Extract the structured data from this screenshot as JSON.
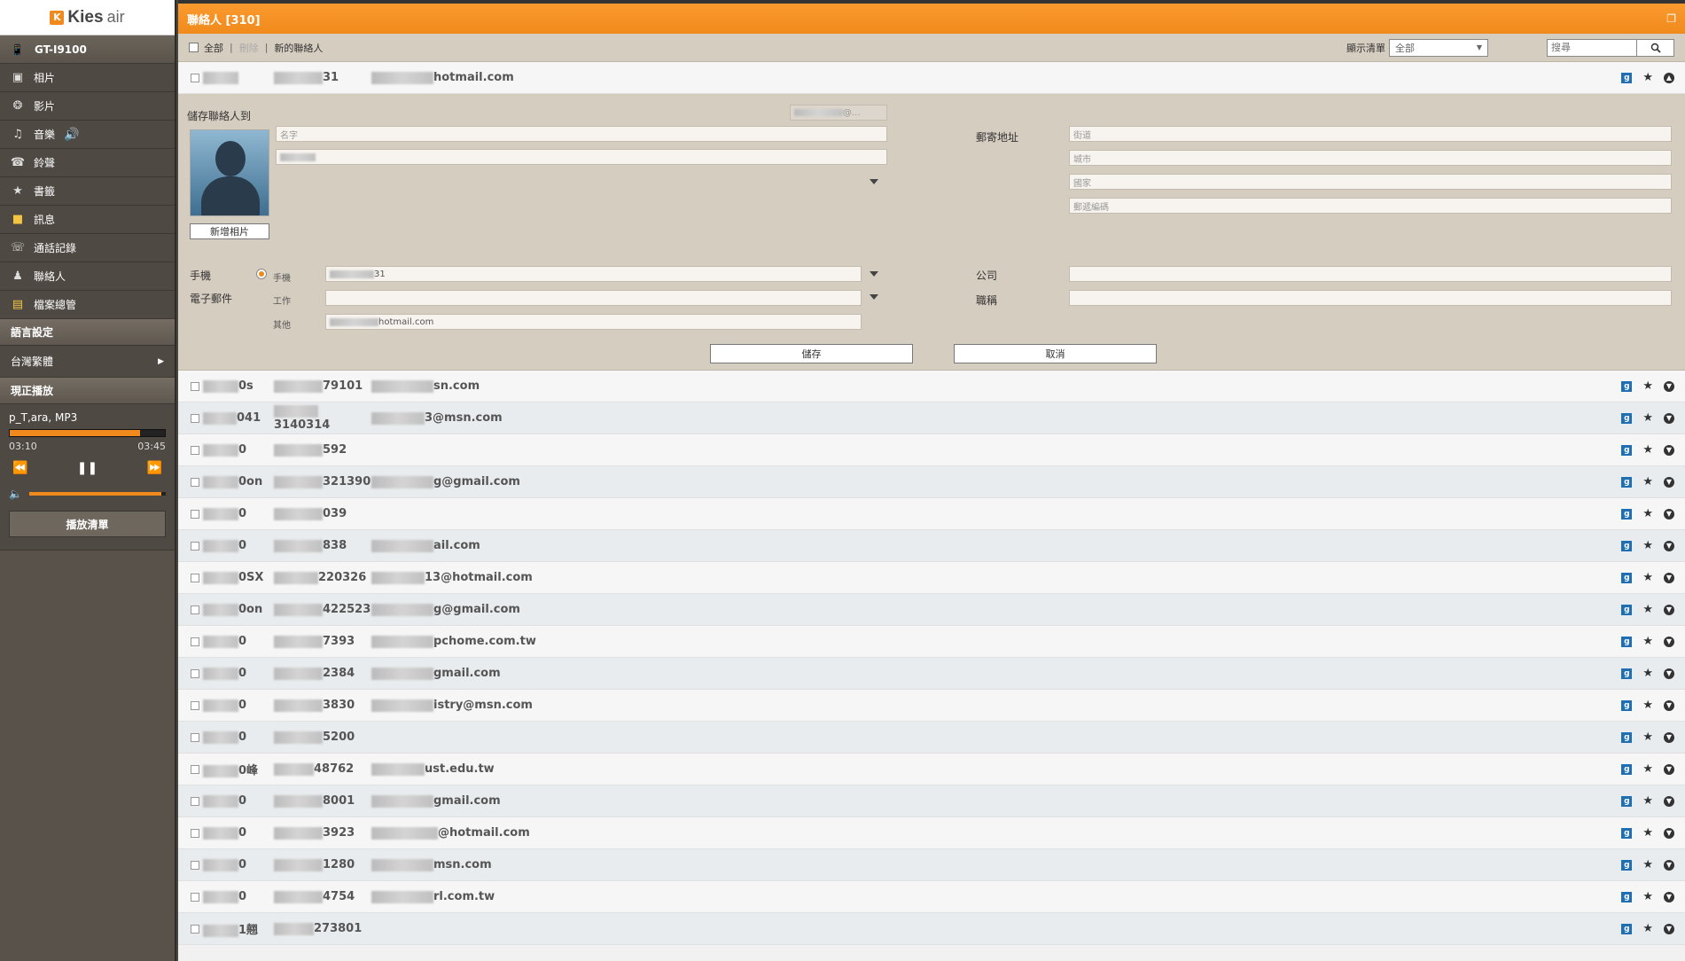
{
  "app": {
    "logo_mark": "K",
    "logo_name": "Kies",
    "logo_sub": "air"
  },
  "sidebar": {
    "device": "GT-I9100",
    "items": [
      {
        "label": "相片",
        "icon": "photo-icon"
      },
      {
        "label": "影片",
        "icon": "film-icon"
      },
      {
        "label": "音樂",
        "icon": "music-icon"
      },
      {
        "label": "鈴聲",
        "icon": "ringtone-icon"
      },
      {
        "label": "書籤",
        "icon": "bookmark-icon"
      },
      {
        "label": "訊息",
        "icon": "message-icon"
      },
      {
        "label": "通話記錄",
        "icon": "call-log-icon"
      },
      {
        "label": "聯絡人",
        "icon": "contact-icon"
      },
      {
        "label": "檔案總管",
        "icon": "folder-icon"
      }
    ],
    "language_section": "語言設定",
    "language_value": "台灣繁體",
    "now_playing_section": "現正播放",
    "player": {
      "track": "p_T,ara, MP3",
      "elapsed": "03:10",
      "total": "03:45",
      "progress": 0.84,
      "volume": 0.97
    },
    "playlist_button": "播放清單"
  },
  "header": {
    "title": "聯絡人 [310]"
  },
  "toolbar": {
    "select_all": "全部",
    "delete": "刪除",
    "new_contact": "新的聯絡人",
    "display_list_label": "顯示清單",
    "display_list_value": "全部",
    "search_placeholder": "搜尋"
  },
  "first_row": {
    "c1": "",
    "c2": "31",
    "c3": "hotmail.com"
  },
  "edit": {
    "save_to_label": "儲存聯絡人到",
    "account_value": "@...",
    "name_placeholder": "名字",
    "add_photo": "新增相片",
    "address_label": "郵寄地址",
    "street": "街道",
    "city": "城市",
    "country": "國家",
    "zip": "郵遞編碼",
    "mobile_label": "手機",
    "mobile_type": "手機",
    "mobile_value": "31",
    "email_label": "電子郵件",
    "work_type": "工作",
    "other_type": "其他",
    "other_email_value": "hotmail.com",
    "company_label": "公司",
    "title_label": "職稱",
    "save": "儲存",
    "cancel": "取消"
  },
  "contacts": [
    {
      "c1": "0s",
      "c2": "79101",
      "c3": "sn.com"
    },
    {
      "c1": "041",
      "c2": "3140314",
      "c3": "3@msn.com"
    },
    {
      "c1": "0",
      "c2": "592",
      "c3": ""
    },
    {
      "c1": "0on",
      "c2": "321390",
      "c3": "g@gmail.com"
    },
    {
      "c1": "0",
      "c2": "039",
      "c3": ""
    },
    {
      "c1": "0",
      "c2": "838",
      "c3": "ail.com"
    },
    {
      "c1": "0SX",
      "c2": "220326",
      "c3": "13@hotmail.com"
    },
    {
      "c1": "0on",
      "c2": "422523",
      "c3": "g@gmail.com"
    },
    {
      "c1": "0",
      "c2": "7393",
      "c3": "pchome.com.tw"
    },
    {
      "c1": "0",
      "c2": "2384",
      "c3": "gmail.com"
    },
    {
      "c1": "0",
      "c2": "3830",
      "c3": "istry@msn.com"
    },
    {
      "c1": "0",
      "c2": "5200",
      "c3": ""
    },
    {
      "c1": "0峰",
      "c2": "48762",
      "c3": "ust.edu.tw"
    },
    {
      "c1": "0",
      "c2": "8001",
      "c3": "gmail.com"
    },
    {
      "c1": "0",
      "c2": "3923",
      "c3": "@hotmail.com"
    },
    {
      "c1": "0",
      "c2": "1280",
      "c3": "msn.com"
    },
    {
      "c1": "0",
      "c2": "4754",
      "c3": "rl.com.tw"
    },
    {
      "c1": "1翹",
      "c2": "273801",
      "c3": ""
    }
  ],
  "colors": {
    "accent": "#f08a1c",
    "sidebar": "#4e4943",
    "form_bg": "#d6cdc1",
    "google_badge": "#1f6fb4"
  }
}
